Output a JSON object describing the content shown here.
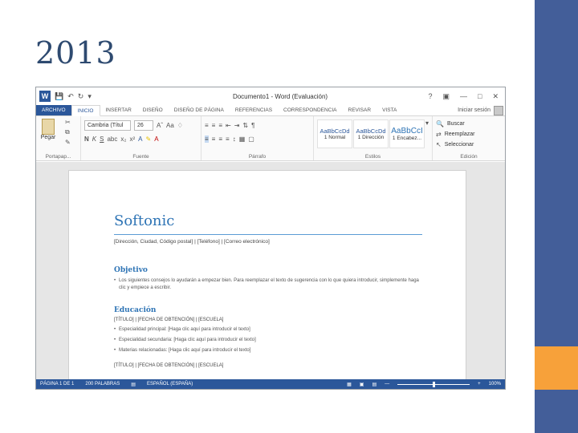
{
  "slide": {
    "title": "2013"
  },
  "word": {
    "titlebar": {
      "doc_title": "Documento1 - Word (Evaluación)",
      "help": "?"
    },
    "tabs": [
      "ARCHIVO",
      "INICIO",
      "INSERTAR",
      "DISEÑO",
      "DISEÑO DE PÁGINA",
      "REFERENCIAS",
      "CORRESPONDENCIA",
      "REVISAR",
      "VISTA"
    ],
    "signin": "Iniciar sesión",
    "ribbon": {
      "paste": "Pegar",
      "font_name": "Cambria (Títul",
      "font_size": "26",
      "font_btns": [
        "N",
        "K",
        "S"
      ],
      "style_samples": [
        {
          "sample": "AaBbCcDd",
          "label": "1 Normal"
        },
        {
          "sample": "AaBbCcDd",
          "label": "1 Dirección"
        },
        {
          "sample": "AaBbCcI",
          "label": "1 Encabez..."
        }
      ],
      "buscar": "Buscar",
      "reemplazar": "Reemplazar",
      "seleccionar": "Seleccionar",
      "groups": [
        "Portapap...",
        "Fuente",
        "Párrafo",
        "Estilos",
        "Edición"
      ]
    },
    "document": {
      "name": "Softonic",
      "contact": "[Dirección, Ciudad, Código postal] | [Teléfono] | [Correo electrónico]",
      "objective_heading": "Objetivo",
      "objective_text": "Los siguientes consejos lo ayudarán a empezar bien. Para reemplazar el texto de sugerencia con lo que quiera introducir, simplemente haga clic y empiece a escribir.",
      "education_heading": "Educación",
      "edu1": "[TÍTULO] | [FECHA DE OBTENCIÓN] | [ESCUELA]",
      "edu1_bullets": [
        "Especialidad principal: [Haga clic aquí para introducir el texto]",
        "Especialidad secundaria: [Haga clic aquí para introducir el texto]",
        "Materias relacionadas: [Haga clic aquí para introducir el texto]"
      ],
      "edu2": "[TÍTULO] | [FECHA DE OBTENCIÓN] | [ESCUELA]"
    },
    "statusbar": {
      "page": "PÁGINA 1 DE 1",
      "words": "200 PALABRAS",
      "lang": "ESPAÑOL (ESPAÑA)",
      "zoom": "100%"
    }
  }
}
